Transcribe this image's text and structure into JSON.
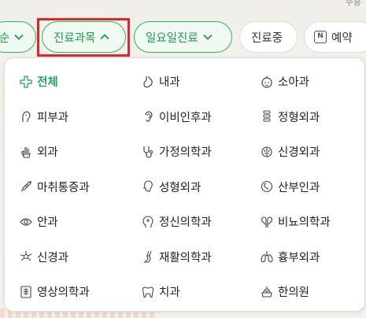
{
  "map": {
    "top_text": "주흥"
  },
  "filters": {
    "sort": "순",
    "department": "진료과목",
    "sunday": "일요일진료",
    "open_now": "진료중",
    "reserve": "예약"
  },
  "departments": [
    {
      "label": "전체",
      "icon": "plus-icon",
      "active": true
    },
    {
      "label": "내과",
      "icon": "stomach-icon"
    },
    {
      "label": "소아과",
      "icon": "baby-icon"
    },
    {
      "label": "피부과",
      "icon": "skin-icon"
    },
    {
      "label": "이비인후과",
      "icon": "ear-icon"
    },
    {
      "label": "정형외과",
      "icon": "spine-icon"
    },
    {
      "label": "외과",
      "icon": "hand-icon"
    },
    {
      "label": "가정의학과",
      "icon": "stethoscope-icon"
    },
    {
      "label": "신경외과",
      "icon": "brain-icon"
    },
    {
      "label": "마취통증과",
      "icon": "syringe-icon"
    },
    {
      "label": "성형외과",
      "icon": "face-icon"
    },
    {
      "label": "산부인과",
      "icon": "womb-icon"
    },
    {
      "label": "안과",
      "icon": "eye-icon"
    },
    {
      "label": "정신의학과",
      "icon": "head-icon"
    },
    {
      "label": "비뇨의학과",
      "icon": "kidney-icon"
    },
    {
      "label": "신경과",
      "icon": "neuron-icon"
    },
    {
      "label": "재활의학과",
      "icon": "leg-icon"
    },
    {
      "label": "흉부외과",
      "icon": "lungs-icon"
    },
    {
      "label": "영상의학과",
      "icon": "xray-icon"
    },
    {
      "label": "치과",
      "icon": "tooth-icon"
    },
    {
      "label": "한의원",
      "icon": "herb-icon"
    }
  ]
}
